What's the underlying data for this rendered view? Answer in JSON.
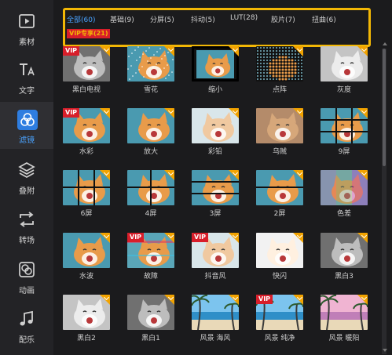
{
  "sidebar": {
    "items": [
      {
        "label": "素材",
        "icon": "play-box-icon",
        "active": false
      },
      {
        "label": "文字",
        "icon": "text-icon",
        "active": false
      },
      {
        "label": "滤镜",
        "icon": "filter-icon",
        "active": true
      },
      {
        "label": "叠附",
        "icon": "layers-icon",
        "active": false
      },
      {
        "label": "转场",
        "icon": "transition-icon",
        "active": false
      },
      {
        "label": "动画",
        "icon": "animation-icon",
        "active": false
      },
      {
        "label": "配乐",
        "icon": "music-note-icon",
        "active": false
      }
    ]
  },
  "tabs": [
    {
      "label": "全部(60)",
      "state": "active"
    },
    {
      "label": "基础(9)",
      "state": "normal"
    },
    {
      "label": "分屏(5)",
      "state": "normal"
    },
    {
      "label": "抖动(5)",
      "state": "normal"
    },
    {
      "label": "LUT(28)",
      "state": "normal"
    },
    {
      "label": "胶片(7)",
      "state": "normal"
    },
    {
      "label": "扭曲(6)",
      "state": "normal"
    },
    {
      "label": "VIP专享(21)",
      "state": "vip"
    }
  ],
  "badge_text": {
    "vip": "VIP"
  },
  "filters": [
    {
      "label": "黑白电视",
      "style": "gray",
      "vip": true,
      "download": true
    },
    {
      "label": "雪花",
      "style": "snow",
      "vip": false,
      "download": true
    },
    {
      "label": "缩小",
      "style": "shrink",
      "vip": false,
      "download": true,
      "selected": true
    },
    {
      "label": "点阵",
      "style": "dots",
      "vip": false,
      "download": true
    },
    {
      "label": "灰度",
      "style": "lightgray",
      "vip": false,
      "download": true
    },
    {
      "label": "水彩",
      "style": "color",
      "vip": true,
      "download": true
    },
    {
      "label": "放大",
      "style": "color",
      "vip": false,
      "download": true
    },
    {
      "label": "彩铅",
      "style": "pale",
      "vip": false,
      "download": true
    },
    {
      "label": "乌贼",
      "style": "sepia",
      "vip": false,
      "download": true
    },
    {
      "label": "9屏",
      "style": "split9",
      "vip": false,
      "download": true
    },
    {
      "label": "6屏",
      "style": "split6",
      "vip": false,
      "download": true
    },
    {
      "label": "4屏",
      "style": "split4",
      "vip": false,
      "download": true
    },
    {
      "label": "3屏",
      "style": "split3",
      "vip": false,
      "download": true
    },
    {
      "label": "2屏",
      "style": "split2",
      "vip": false,
      "download": true
    },
    {
      "label": "色差",
      "style": "rainbow",
      "vip": false,
      "download": true
    },
    {
      "label": "水波",
      "style": "color",
      "vip": false,
      "download": true
    },
    {
      "label": "故障",
      "style": "glitch",
      "vip": true,
      "download": true
    },
    {
      "label": "抖音风",
      "style": "pale",
      "vip": true,
      "download": true
    },
    {
      "label": "快闪",
      "style": "flash",
      "vip": false,
      "download": true
    },
    {
      "label": "黑白3",
      "style": "gray",
      "vip": false,
      "download": true
    },
    {
      "label": "黑白2",
      "style": "lightgray",
      "vip": false,
      "download": true
    },
    {
      "label": "黑白1",
      "style": "gray",
      "vip": false,
      "download": true
    },
    {
      "label": "风景 海风",
      "style": "beach",
      "vip": false,
      "download": true
    },
    {
      "label": "风景 纯净",
      "style": "beach",
      "vip": true,
      "download": true
    },
    {
      "label": "风景 暖阳",
      "style": "beachpink",
      "vip": false,
      "download": true
    }
  ]
}
